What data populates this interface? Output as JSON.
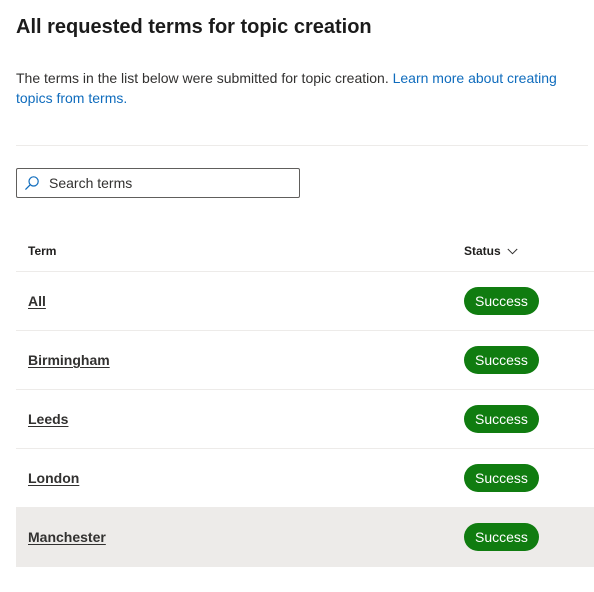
{
  "page": {
    "title": "All requested terms for topic creation",
    "description": "The terms in the list below were submitted for topic creation. ",
    "learn_more_link": "Learn more about creating topics from terms."
  },
  "search": {
    "placeholder": "Search terms",
    "value": ""
  },
  "table": {
    "columns": {
      "term": "Term",
      "status": "Status"
    },
    "rows": [
      {
        "term": "All",
        "status": "Success"
      },
      {
        "term": "Birmingham",
        "status": "Success"
      },
      {
        "term": "Leeds",
        "status": "Success"
      },
      {
        "term": "London",
        "status": "Success"
      },
      {
        "term": "Manchester",
        "status": "Success"
      }
    ],
    "highlighted_row": "Manchester"
  },
  "colors": {
    "accent_link": "#0f6cbd",
    "success_badge": "#107c10",
    "row_highlight": "#edebe9"
  },
  "icons": {
    "search": "search-icon",
    "sort": "chevron-down-icon"
  }
}
